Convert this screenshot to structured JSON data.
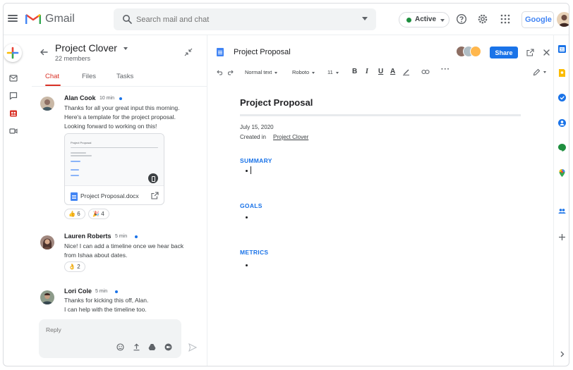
{
  "app": {
    "name": "Gmail",
    "search_placeholder": "Search mail and chat",
    "status": "Active",
    "brand": "Google",
    "colors": {
      "accent": "#1a73e8",
      "red": "#d93025",
      "green": "#1e8e3e",
      "yellow": "#fbbc04"
    }
  },
  "room": {
    "title": "Project Clover",
    "members": "22 members",
    "tabs": [
      {
        "label": "Chat",
        "active": true
      },
      {
        "label": "Files",
        "active": false
      },
      {
        "label": "Tasks",
        "active": false
      }
    ]
  },
  "messages": [
    {
      "author": "Alan Cook",
      "time": "10 min",
      "lines": [
        "Thanks for all your great input this morning.",
        "Here's a template for the project proposal.",
        "Looking forward to working on this!"
      ],
      "attachment": {
        "name": "Project Proposal.docx",
        "preview_title": "Project Proposal"
      },
      "reactions": [
        {
          "emoji": "👍",
          "count": "6"
        },
        {
          "emoji": "🎉",
          "count": "4"
        }
      ]
    },
    {
      "author": "Lauren Roberts",
      "time": "5 min",
      "lines": [
        "Nice! I can add a timeline once we hear back",
        "from Ishaa about dates."
      ],
      "reactions": [
        {
          "emoji": "👌",
          "count": "2"
        }
      ]
    },
    {
      "author": "Lori Cole",
      "time": "5 min",
      "lines": [
        "Thanks for kicking this off, Alan.",
        "I can help with the timeline too."
      ]
    }
  ],
  "reply": {
    "placeholder": "Reply"
  },
  "doc": {
    "bar_title": "Project Proposal",
    "share_label": "Share",
    "toolbar": {
      "style": "Normal text",
      "font": "Roboto",
      "size": "11",
      "bold": "B",
      "italic": "I",
      "underline": "U",
      "text_color": "A"
    },
    "heading": "Project Proposal",
    "date": "July 15, 2020",
    "created_prefix": "Created in",
    "created_link": "Project Clover",
    "sections": [
      "SUMMARY",
      "GOALS",
      "METRICS"
    ]
  },
  "icons": {
    "rail": [
      "compose-icon",
      "mail-icon",
      "chat-icon",
      "rooms-icon",
      "meet-icon"
    ],
    "right_rail": [
      "calendar-icon",
      "keep-icon",
      "tasks-icon",
      "contacts-icon",
      "hangouts-icon",
      "maps-icon",
      "groups-icon",
      "add-icon",
      "expand-icon"
    ]
  }
}
